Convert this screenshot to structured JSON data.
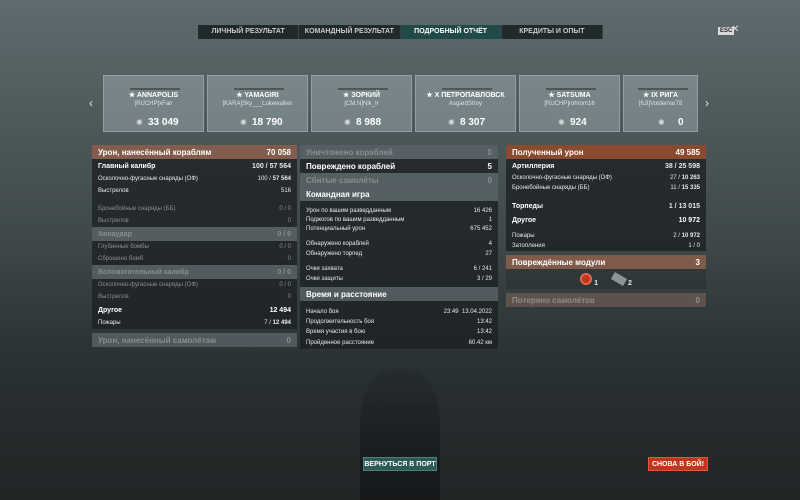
{
  "tabs": [
    "ЛИЧНЫЙ РЕЗУЛЬТАТ",
    "КОМАНДНЫЙ РЕЗУЛЬТАТ",
    "ПОДРОБНЫЙ ОТЧЁТ",
    "КРЕДИТЫ И ОПЫТ"
  ],
  "active_tab": 2,
  "esc_label": "ESC",
  "close_label": "✕",
  "arrow_left": "‹",
  "arrow_right": "›",
  "cards": [
    {
      "name": "★ ANNAPOLIS",
      "player": "[RUCHP]xFair",
      "score": "33 049"
    },
    {
      "name": "★ YAMAGIRI",
      "player": "[KARA]Sky___Lukewalker",
      "score": "18 790"
    },
    {
      "name": "★ ЗОРКИЙ",
      "player": "[CM.N]Nik_Ir",
      "score": "8 988"
    },
    {
      "name": "★ X ПЕТРОПАВЛОВСК",
      "player": "AsgardStroy",
      "score": "8 307"
    },
    {
      "name": "★ SATSUMA",
      "player": "[RUCHP]rohrom16",
      "score": "924"
    },
    {
      "name": "★ IX РИГА",
      "player": "[6JI]Voldemar78",
      "score": "0"
    }
  ],
  "left": {
    "damage_header": {
      "label": "Урон, нанесённый кораблям",
      "value": "70 058"
    },
    "main_caliber": {
      "label": "Главный калибр",
      "value_a": "100",
      "value_b": "57 564"
    },
    "he_shells": {
      "label": "Осколочно-фугасные снаряды (ОФ)",
      "value_a": "100",
      "value_b": "57 564"
    },
    "shots": {
      "label": "Выстрелов",
      "value": "516"
    },
    "ap_shells": {
      "label": "Бронебойные снаряды (ББ)",
      "value": "0 / 0"
    },
    "ap_shots": {
      "label": "Выстрелов",
      "value": "0"
    },
    "air_strike": {
      "label": "Авиаудар",
      "value": "0 / 0"
    },
    "depth_charges": {
      "label": "Глубинные бомбы",
      "value": "0 / 0"
    },
    "dropped_bombs": {
      "label": "Сброшено бомб",
      "value": "0"
    },
    "secondary": {
      "label": "Вспомогательный калибр",
      "value": "0 / 0"
    },
    "sec_he": {
      "label": "Осколочно-фугасные снаряды (ОФ)",
      "value": "0 / 0"
    },
    "sec_shots": {
      "label": "Выстрелов",
      "value": "0"
    },
    "other": {
      "label": "Другое",
      "value": "12 494"
    },
    "fires": {
      "label": "Пожары",
      "value_a": "7",
      "value_b": "12 494"
    },
    "planes_damage": {
      "label": "Урон, нанесённый самолётам",
      "value": "0"
    }
  },
  "center": {
    "destroyed": {
      "label": "Уничтожено кораблей",
      "value": "0"
    },
    "damaged": {
      "label": "Повреждено кораблей",
      "value": "5"
    },
    "planes": {
      "label": "Сбитые самолёты",
      "value": "0"
    },
    "team_header": "Командная игра",
    "spot_damage": {
      "label": "Урон по вашим разведданным",
      "value": "16 426"
    },
    "spot_fires": {
      "label": "Поджогов по вашим разведданным",
      "value": "1"
    },
    "potential": {
      "label": "Потенциальный урон",
      "value": "675 452"
    },
    "ships_spotted": {
      "label": "Обнаружено кораблей",
      "value": "4"
    },
    "torps_spotted": {
      "label": "Обнаружено торпед",
      "value": "27"
    },
    "capture": {
      "label": "Очки захвата",
      "value": "6 / 241"
    },
    "defense": {
      "label": "Очки защиты",
      "value": "3 / 29"
    },
    "time_header": "Время и расстояние",
    "battle_start": {
      "label": "Начало боя",
      "time": "23:49",
      "date": "13.04.2022"
    },
    "duration": {
      "label": "Продолжительность боя",
      "value": "13:42"
    },
    "participation": {
      "label": "Время участия в бою",
      "value": "13:42"
    },
    "distance": {
      "label": "Пройденное расстояние",
      "value": "60.42 км"
    }
  },
  "right": {
    "received": {
      "label": "Полученный урон",
      "value": "49 585"
    },
    "artillery": {
      "label": "Артиллерия",
      "value_a": "38",
      "value_b": "25 598"
    },
    "r_he": {
      "label": "Осколочно-фугасные снаряды (ОФ)",
      "value_a": "27",
      "value_b": "10 263"
    },
    "r_ap": {
      "label": "Бронебойные снаряды (ББ)",
      "value_a": "11",
      "value_b": "15 335"
    },
    "torpedoes": {
      "label": "Торпеды",
      "value_a": "1",
      "value_b": "13 015"
    },
    "other": {
      "label": "Другое",
      "value": "10 972"
    },
    "r_fires": {
      "label": "Пожары",
      "value_a": "2",
      "value_b": "10 972"
    },
    "flooding": {
      "label": "Затопления",
      "value": "1 / 0"
    },
    "modules": {
      "label": "Повреждённые модули",
      "value": "3"
    },
    "module_icons": [
      {
        "name": "fire-module-icon",
        "count": "1"
      },
      {
        "name": "torpedo-module-icon",
        "count": "2"
      }
    ],
    "planes_lost": {
      "label": "Потеряно самолётов",
      "value": "0"
    }
  },
  "buttons": {
    "port": "ВЕРНУТЬСЯ В ПОРТ",
    "battle": "СНОВА В БОЙ!"
  }
}
